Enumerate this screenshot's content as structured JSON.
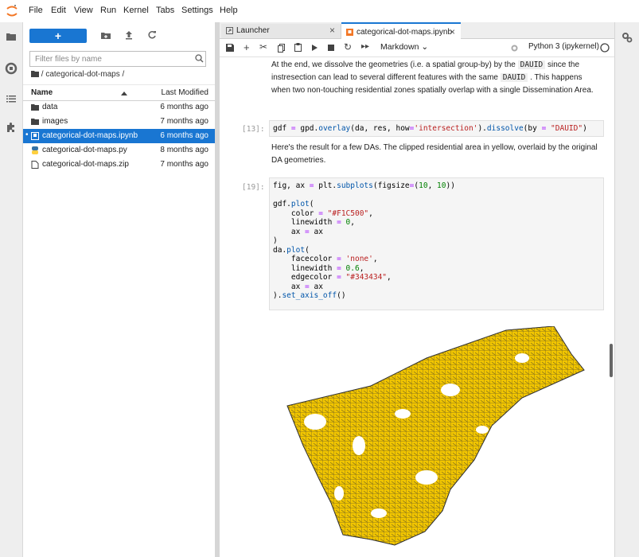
{
  "menubar": {
    "items": [
      "File",
      "Edit",
      "View",
      "Run",
      "Kernel",
      "Tabs",
      "Settings",
      "Help"
    ]
  },
  "filebrowser": {
    "new_label": "+",
    "filter_placeholder": "Filter files by name",
    "breadcrumb": "/ categorical-dot-maps /",
    "col_name": "Name",
    "col_modified": "Last Modified",
    "files": [
      {
        "name": "data",
        "modified": "6 months ago",
        "icon": "folder-icon"
      },
      {
        "name": "images",
        "modified": "7 months ago",
        "icon": "folder-icon"
      },
      {
        "name": "categorical-dot-maps.ipynb",
        "modified": "6 months ago",
        "icon": "notebook-icon",
        "selected": true
      },
      {
        "name": "categorical-dot-maps.py",
        "modified": "8 months ago",
        "icon": "python-icon"
      },
      {
        "name": "categorical-dot-maps.zip",
        "modified": "7 months ago",
        "icon": "file-icon"
      }
    ]
  },
  "tabs": [
    {
      "label": "Launcher",
      "icon": "launcher-icon"
    },
    {
      "label": "categorical-dot-maps.ipynb",
      "icon": "notebook-icon",
      "active": true
    }
  ],
  "toolbar": {
    "cell_type": "Markdown",
    "kernel": "Python 3 (ipykernel)"
  },
  "notebook": {
    "md1": {
      "t1": "At the end, we dissolve the geometries (i.e. a spatial group-by) by the ",
      "c1": "DAUID",
      "t2": " since the instresection can lead to several different features with the same ",
      "c2": "DAUID",
      "t3": " . This happens when two non-touching residential zones spatially overlap with a single Dissemination Area."
    },
    "cell13_prompt": "[13]:",
    "md2": "Here's the result for a few DAs. The clipped residential area in yellow, overlaid by the original DA geometries.",
    "cell19_prompt": "[19]:"
  },
  "colors": {
    "accent": "#1976d2",
    "map_fill": "#F1C500",
    "map_edge": "#343434"
  }
}
